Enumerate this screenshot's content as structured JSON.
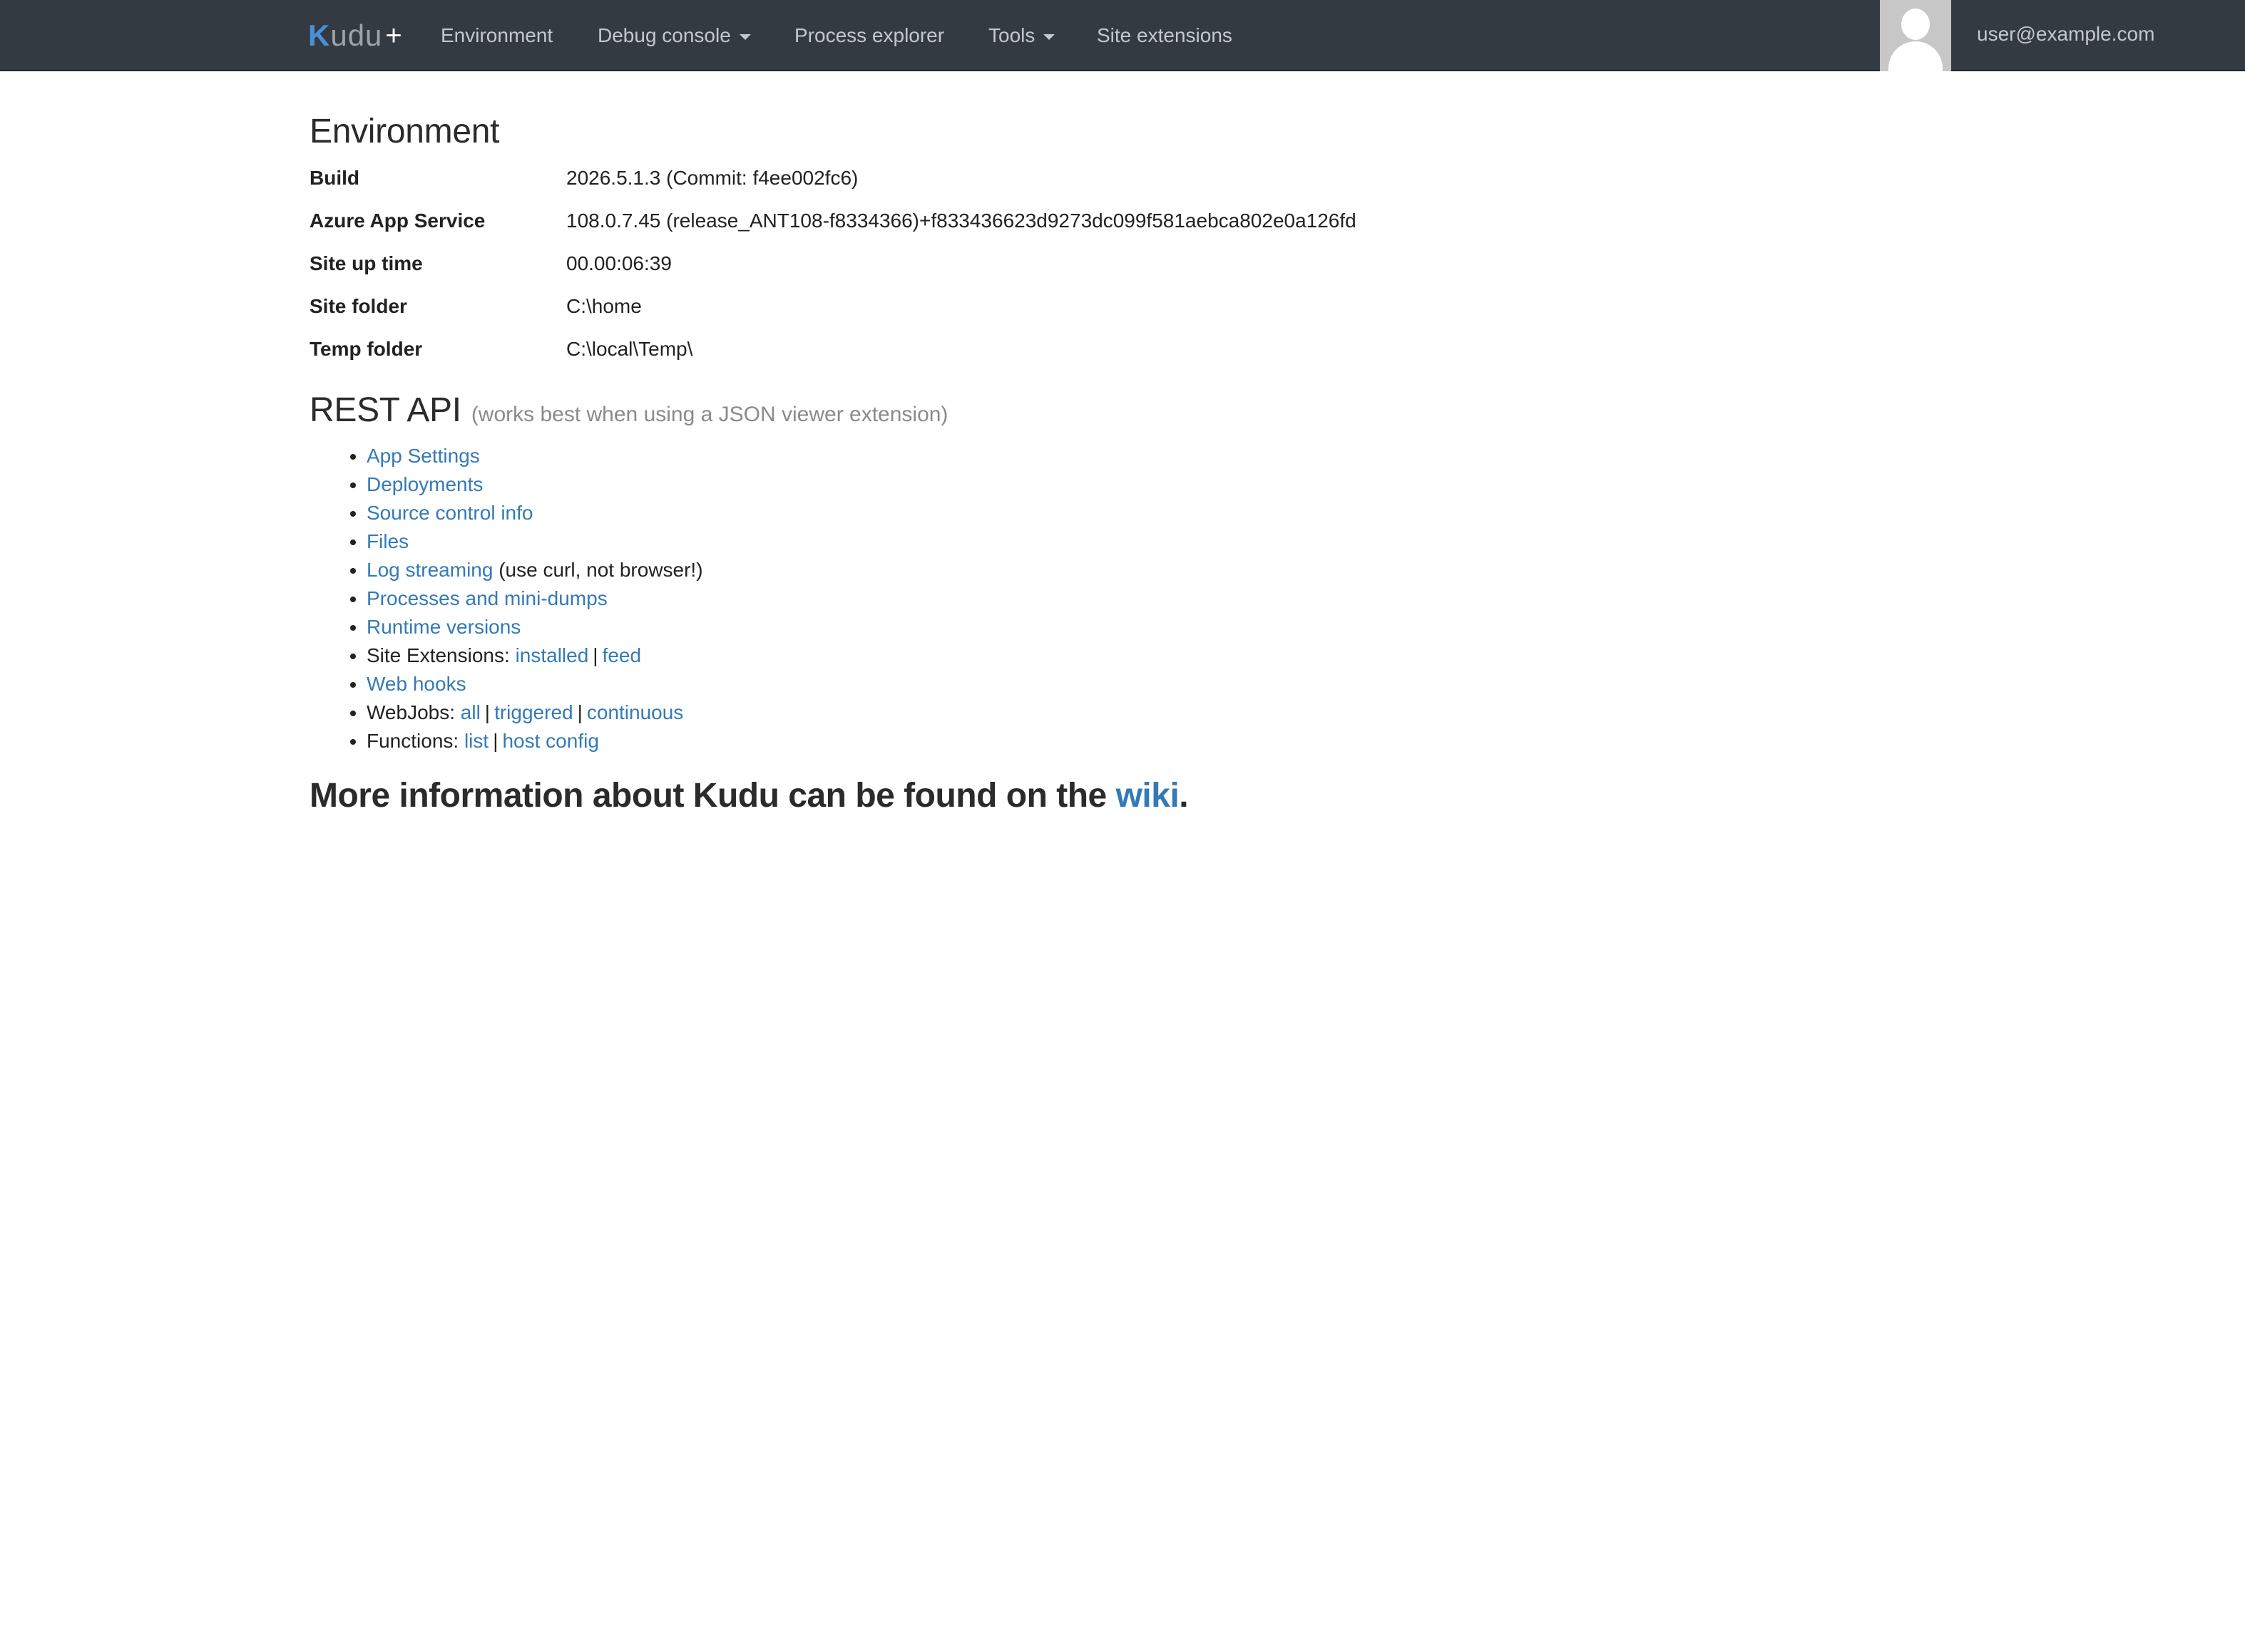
{
  "navbar": {
    "brand": {
      "first_letter": "K",
      "rest": "udu",
      "plus": "+"
    },
    "items": [
      {
        "label": "Environment"
      },
      {
        "label": "Debug console",
        "dropdown": true
      },
      {
        "label": "Process explorer"
      },
      {
        "label": "Tools",
        "dropdown": true
      },
      {
        "label": "Site extensions"
      }
    ],
    "user_email": "user@example.com",
    "avatar_icon": "user-avatar-icon"
  },
  "environment": {
    "title": "Environment",
    "rows": [
      {
        "key": "Build",
        "value": "2026.5.1.3 (Commit: f4ee002fc6)"
      },
      {
        "key": "Azure App Service",
        "value": "108.0.7.45 (release_ANT108-f8334366)+f833436623d9273dc099f581aebca802e0a126fd"
      },
      {
        "key": "Site up time",
        "value": "00.00:06:39"
      },
      {
        "key": "Site folder",
        "value": "C:\\home"
      },
      {
        "key": "Temp folder",
        "value": "C:\\local\\Temp\\"
      }
    ]
  },
  "rest_api": {
    "title": "REST API",
    "subtitle": "(works best when using a JSON viewer extension)",
    "items": {
      "app_settings": "App Settings",
      "deployments": "Deployments",
      "source_control": "Source control info",
      "files": "Files",
      "log_streaming": "Log streaming",
      "log_streaming_note": "(use curl, not browser!)",
      "processes": "Processes and mini-dumps",
      "runtime_versions": "Runtime versions",
      "site_extensions_label": "Site Extensions:",
      "site_extensions_installed": "installed",
      "site_extensions_feed": "feed",
      "web_hooks": "Web hooks",
      "webjobs_label": "WebJobs:",
      "webjobs_all": "all",
      "webjobs_triggered": "triggered",
      "webjobs_continuous": "continuous",
      "functions_label": "Functions:",
      "functions_list": "list",
      "functions_host_config": "host config",
      "separator": "|"
    }
  },
  "more_info": {
    "prefix": "More information about Kudu can be found on the",
    "link": "wiki",
    "suffix": "."
  },
  "colors": {
    "navbar_bg": "#343a41",
    "link": "#337ab7",
    "brand_accent": "#4a90d9"
  }
}
